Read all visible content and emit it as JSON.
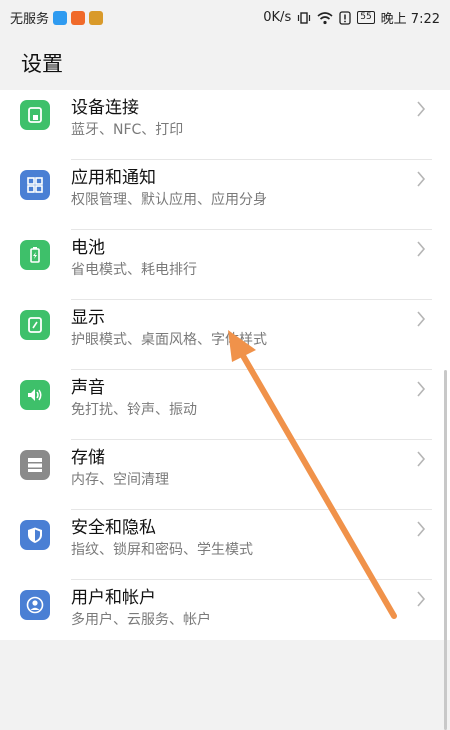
{
  "status_bar": {
    "carrier": "无服务",
    "speed": "0K/s",
    "battery": "55",
    "time": "晚上 7:22"
  },
  "header": {
    "title": "设置"
  },
  "items": [
    {
      "label": "设备连接",
      "sub": "蓝牙、NFC、打印",
      "icon": "device-connection-icon",
      "color": "#3ec06a"
    },
    {
      "label": "应用和通知",
      "sub": "权限管理、默认应用、应用分身",
      "icon": "apps-grid-icon",
      "color": "#4a7fd4"
    },
    {
      "label": "电池",
      "sub": "省电模式、耗电排行",
      "icon": "battery-icon",
      "color": "#3ec06a"
    },
    {
      "label": "显示",
      "sub": "护眼模式、桌面风格、字体样式",
      "icon": "display-icon",
      "color": "#3ec06a"
    },
    {
      "label": "声音",
      "sub": "免打扰、铃声、振动",
      "icon": "speaker-icon",
      "color": "#3ec06a"
    },
    {
      "label": "存储",
      "sub": "内存、空间清理",
      "icon": "storage-icon",
      "color": "#8a8a8a"
    },
    {
      "label": "安全和隐私",
      "sub": "指纹、锁屏和密码、学生模式",
      "icon": "shield-icon",
      "color": "#4a7fd4"
    },
    {
      "label": "用户和帐户",
      "sub": "多用户、云服务、帐户",
      "icon": "user-icon",
      "color": "#4a7fd4"
    }
  ],
  "annotation": {
    "color": "#f0924a"
  }
}
